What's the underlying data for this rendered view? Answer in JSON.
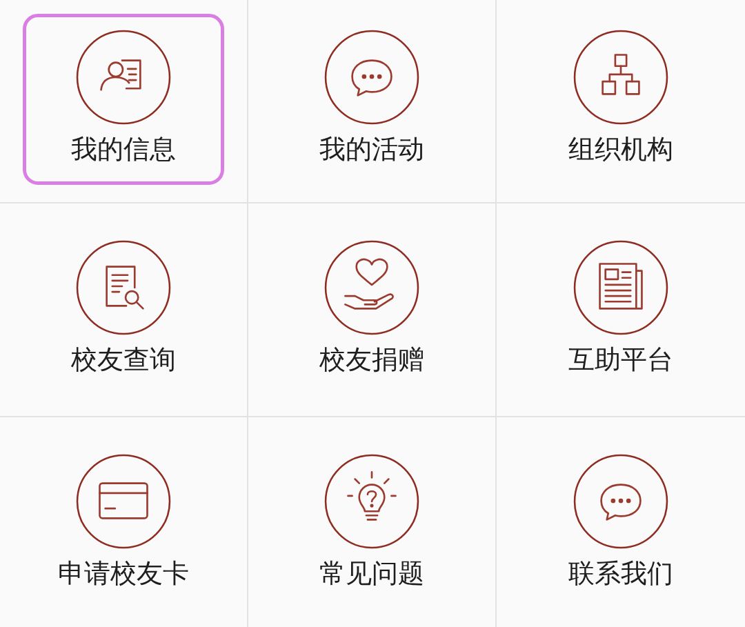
{
  "menu": [
    {
      "label": "我的信息",
      "selected": true
    },
    {
      "label": "我的活动",
      "selected": false
    },
    {
      "label": "组织机构",
      "selected": false
    },
    {
      "label": "校友查询",
      "selected": false
    },
    {
      "label": "校友捐赠",
      "selected": false
    },
    {
      "label": "互助平台",
      "selected": false
    },
    {
      "label": "申请校友卡",
      "selected": false
    },
    {
      "label": "常见问题",
      "selected": false
    },
    {
      "label": "联系我们",
      "selected": false
    }
  ]
}
